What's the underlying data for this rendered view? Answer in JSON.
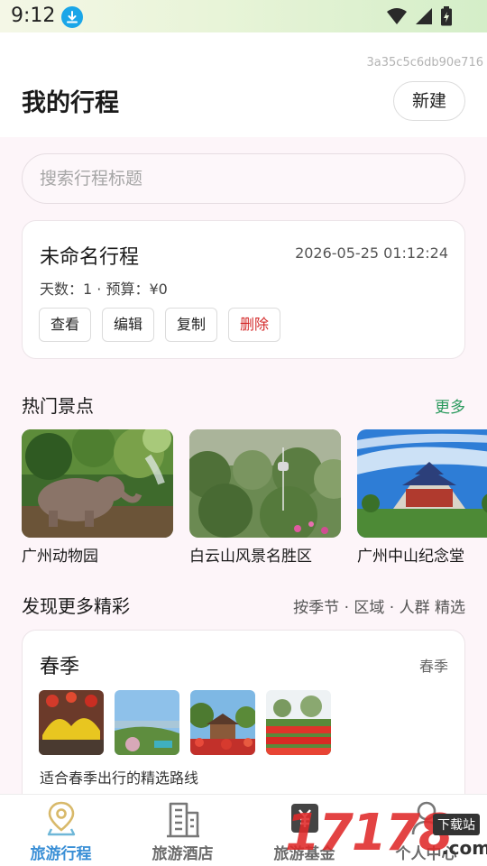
{
  "status_bar": {
    "time": "9:12"
  },
  "header": {
    "device_id": "3a35c5c6db90e716",
    "title": "我的行程",
    "new_button": "新建"
  },
  "search": {
    "placeholder": "搜索行程标题"
  },
  "trip": {
    "title": "未命名行程",
    "timestamp": "2026-05-25 01:12:24",
    "meta": "天数：1 · 预算：¥0",
    "actions": {
      "view": "查看",
      "edit": "编辑",
      "copy": "复制",
      "delete": "删除"
    }
  },
  "hot_spots": {
    "title": "热门景点",
    "more": "更多",
    "items": [
      {
        "name": "广州动物园"
      },
      {
        "name": "白云山风景名胜区"
      },
      {
        "name": "广州中山纪念堂"
      }
    ]
  },
  "discover": {
    "title": "发现更多精彩",
    "subtitle": "按季节 · 区域 · 人群 精选",
    "season_card": {
      "title": "春季",
      "tag": "春季",
      "description": "适合春季出行的精选路线"
    }
  },
  "tabbar": {
    "tabs": [
      {
        "label": "旅游行程",
        "icon": "map-pin-icon",
        "active": true
      },
      {
        "label": "旅游酒店",
        "icon": "hotel-building-icon",
        "active": false
      },
      {
        "label": "旅游基金",
        "icon": "wallet-yen-icon",
        "active": false
      },
      {
        "label": "个人中心",
        "icon": "user-icon",
        "active": false
      }
    ]
  },
  "watermark": {
    "text": "17178",
    "badge": "下载站",
    "domain": ".com"
  },
  "colors": {
    "accent_green": "#2b9a5e",
    "tab_active": "#3a8fd6",
    "danger": "#d42a2a",
    "watermark_red": "#e02a2a"
  }
}
